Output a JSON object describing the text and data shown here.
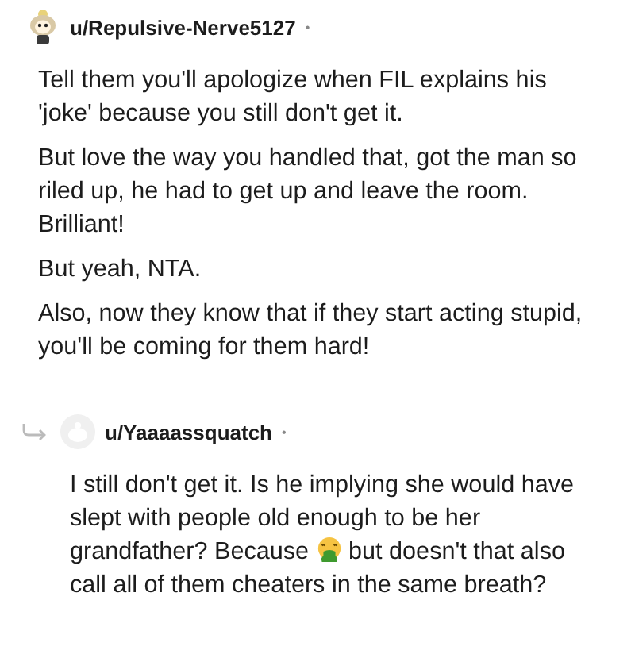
{
  "comments": [
    {
      "author": "u/Repulsive-Nerve5127",
      "dot": "•",
      "reply": false,
      "kind": "snoo",
      "paragraphs": [
        {
          "text": "Tell them you'll apologize when FIL explains his 'joke' because you still don't get it."
        },
        {
          "text": "But love the way you handled that, got the man so riled up, he had to get up and leave the room. Brilliant!"
        },
        {
          "text": "But yeah, NTA."
        },
        {
          "text": "Also, now they know that if they start acting stupid, you'll be coming for them hard!"
        }
      ]
    },
    {
      "author": "u/Yaaaassquatch",
      "dot": "•",
      "reply": true,
      "kind": "plain",
      "paragraphs": [
        {
          "kind": "emoji",
          "text": "I still don't get it. Is he implying she would have slept with people old enough to be her grandfather? Because",
          "after": "but doesn't that also call all of them cheaters in the same breath?"
        }
      ]
    }
  ]
}
